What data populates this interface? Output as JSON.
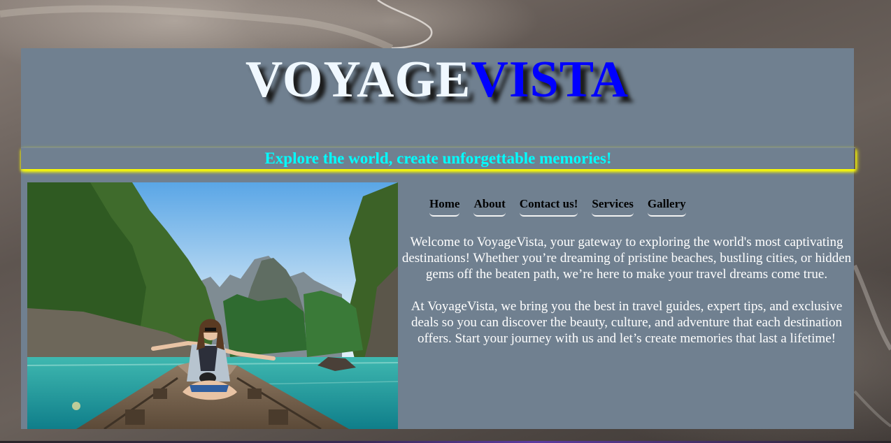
{
  "header": {
    "logo_part_1": "VOYAGE",
    "logo_part_2": "VISTA",
    "tagline": "Explore the world, create unforgettable memories!"
  },
  "nav": {
    "items": [
      {
        "label": "Home"
      },
      {
        "label": "About"
      },
      {
        "label": "Contact us!"
      },
      {
        "label": "Services"
      },
      {
        "label": "Gallery"
      }
    ]
  },
  "main": {
    "paragraph_1": "Welcome to VoyageVista, your gateway to exploring the world's most captivating destinations! Whether you’re dreaming of pristine beaches, bustling cities, or hidden gems off the beaten path, we’re here to make your travel dreams come true.",
    "paragraph_2": "At VoyageVista, we bring you the best in travel guides, expert tips, and exclusive deals so you can discover the beauty, culture, and adventure that each destination offers. Start your journey with us and let’s create memories that last a lifetime!"
  },
  "colors": {
    "panel": "#708090",
    "logo_primary": "#f0f8ff",
    "logo_accent": "#0000ff",
    "tagline": "#00ffff",
    "tagline_glow": "#ffff00"
  }
}
